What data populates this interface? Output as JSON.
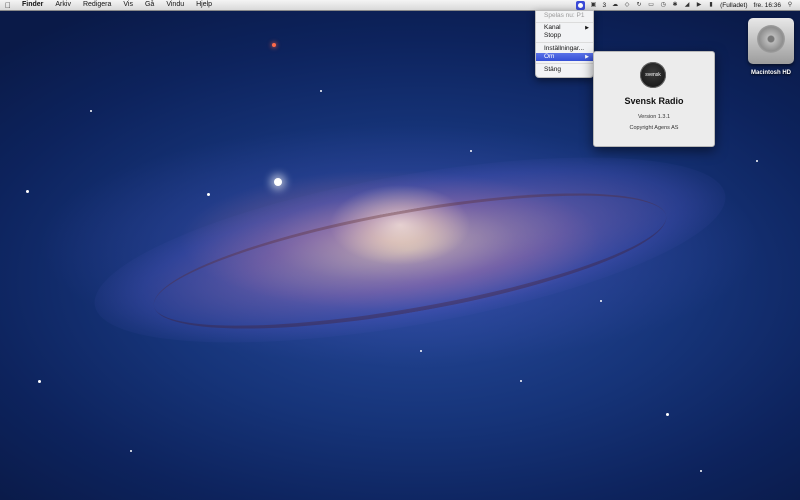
{
  "menubar": {
    "apple_icon": "apple-logo-icon",
    "items": [
      "Finder",
      "Arkiv",
      "Redigera",
      "Vis",
      "Gå",
      "Vindu",
      "Hjelp"
    ],
    "status": {
      "badge_count": "3",
      "battery_text": "(Fulladet)",
      "clock": "fre. 16:36",
      "icons": [
        "svensk-radio-icon",
        "display-icon",
        "cloud-icon",
        "dropbox-icon",
        "sync-icon",
        "airplay-icon",
        "time-machine-icon",
        "bluetooth-icon",
        "wifi-icon",
        "volume-icon",
        "battery-icon",
        "search-icon"
      ]
    }
  },
  "dropdown": {
    "now_playing": "Spelas nu: P1",
    "channel": "Kanal",
    "stop": "Stopp",
    "settings": "Inställningar...",
    "about": "Om",
    "close": "Stäng"
  },
  "about_window": {
    "logo_text": "svensk radio",
    "title": "Svensk Radio",
    "version": "Version 1.3.1",
    "copyright": "Copyright Agens AS"
  },
  "desktop": {
    "hd_label": "Macintosh HD"
  },
  "colors": {
    "menu_highlight": "#3650d6",
    "status_icon_bg": "#3a4ad8"
  }
}
